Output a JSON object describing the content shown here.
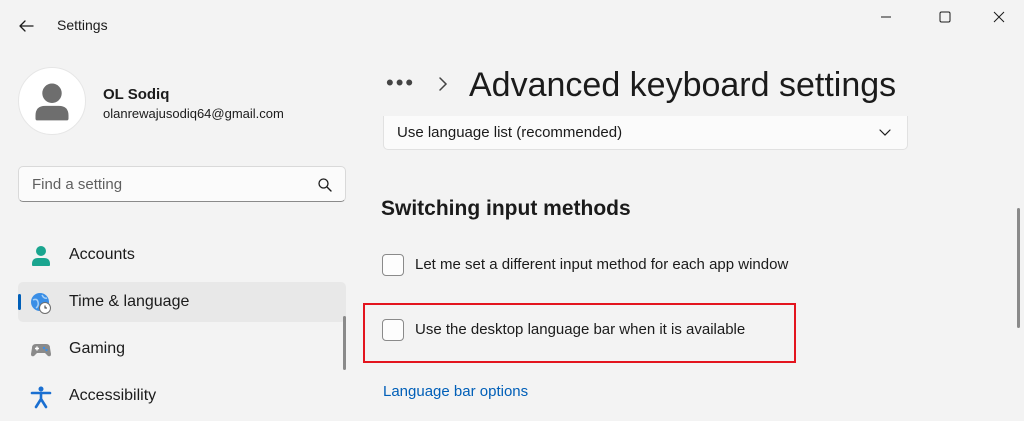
{
  "window": {
    "app_title": "Settings"
  },
  "profile": {
    "name": "OL Sodiq",
    "email": "olanrewajusodiq64@gmail.com"
  },
  "search": {
    "placeholder": "Find a setting"
  },
  "sidebar": {
    "items": [
      {
        "label": "Accounts",
        "icon": "accounts-icon",
        "selected": false
      },
      {
        "label": "Time & language",
        "icon": "time-language-icon",
        "selected": true
      },
      {
        "label": "Gaming",
        "icon": "gaming-icon",
        "selected": false
      },
      {
        "label": "Accessibility",
        "icon": "accessibility-icon",
        "selected": false
      }
    ]
  },
  "breadcrumb": {
    "more": "•••",
    "page_title": "Advanced keyboard settings"
  },
  "dropdown": {
    "value": "Use language list (recommended)"
  },
  "switching": {
    "heading": "Switching input methods",
    "options": [
      {
        "label": "Let me set a different input method for each app window",
        "checked": false
      },
      {
        "label": "Use the desktop language bar when it is available",
        "checked": false
      }
    ]
  },
  "link": {
    "label": "Language bar options"
  },
  "colors": {
    "accent": "#005fb8",
    "highlight": "#e3141e",
    "background": "#f3f3f3"
  }
}
